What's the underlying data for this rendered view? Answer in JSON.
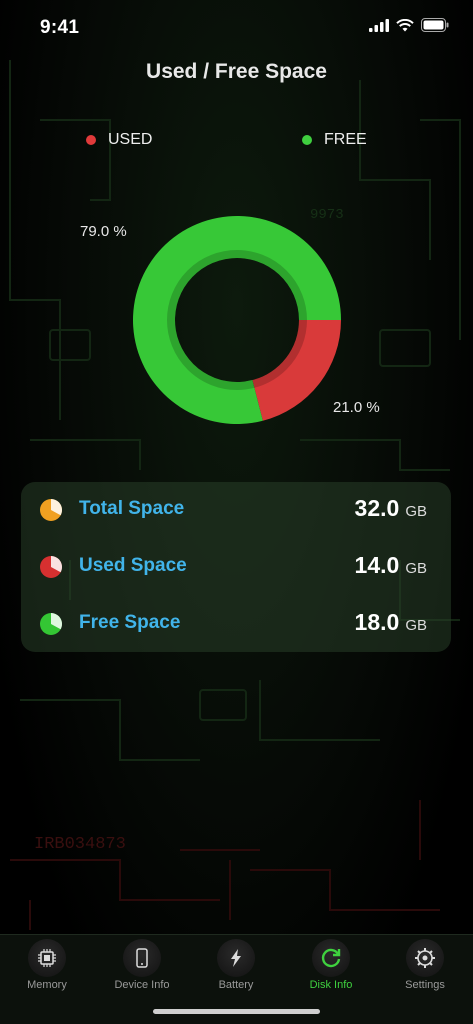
{
  "status_bar": {
    "time": "9:41"
  },
  "title": "Used / Free Space",
  "legend": [
    {
      "label": "USED",
      "color": "#e03a3a"
    },
    {
      "label": "FREE",
      "color": "#3fcf3f"
    }
  ],
  "chart_data": {
    "type": "pie",
    "categories": [
      "USED",
      "FREE"
    ],
    "values": [
      21.0,
      79.0
    ],
    "colors": [
      "#d93a3a",
      "#37c837"
    ],
    "labels": [
      "21.0 %",
      "79.0 %"
    ]
  },
  "storage": [
    {
      "label": "Total Space",
      "value": "32.0",
      "unit": "GB",
      "icon": "pie-orange-icon",
      "color": "#f0a021",
      "fraction": 0.33
    },
    {
      "label": "Used Space",
      "value": "14.0",
      "unit": "GB",
      "icon": "pie-red-icon",
      "color": "#d63030",
      "fraction": 0.33
    },
    {
      "label": "Free Space",
      "value": "18.0",
      "unit": "GB",
      "icon": "pie-green-icon",
      "color": "#34c634",
      "fraction": 0.33
    }
  ],
  "tabs": [
    {
      "label": "Memory",
      "icon": "chip-icon",
      "active": false
    },
    {
      "label": "Device Info",
      "icon": "phone-icon",
      "active": false
    },
    {
      "label": "Battery",
      "icon": "lightning-icon",
      "active": false
    },
    {
      "label": "Disk Info",
      "icon": "refresh-disk-icon",
      "active": true
    },
    {
      "label": "Settings",
      "icon": "gear-icon",
      "active": false
    }
  ],
  "background_text": {
    "code_top": "9973",
    "code_bottom": "IRB034873"
  },
  "colors": {
    "accent": "#3fd13f",
    "label_blue": "#41b4ea"
  }
}
